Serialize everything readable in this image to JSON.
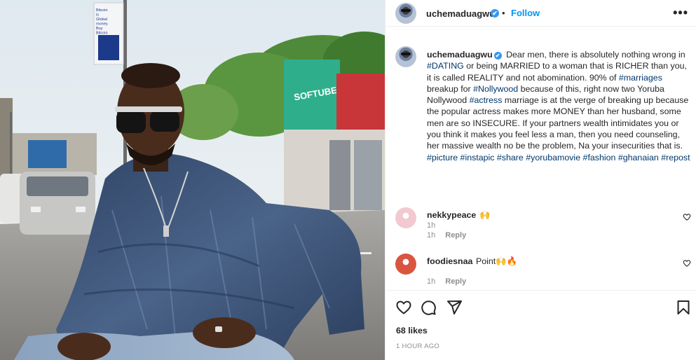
{
  "post": {
    "username": "uchemaduagwu",
    "verified_mark": "✔",
    "separator": "•",
    "follow_label": "Follow",
    "more_label": "•••",
    "photo": {
      "billboard_text": "Bitcoin is Global money. Buy Bitcoin",
      "store_sign": "SOFTUBE"
    }
  },
  "caption": {
    "segments": [
      {
        "t": "Dear men, there is absolutely nothing wrong in "
      },
      {
        "t": "#DATING",
        "tag": true
      },
      {
        "t": " or being MARRIED to a woman that is RICHER than you, it is called REALITY and not abomination. 90% of "
      },
      {
        "t": "#marriages",
        "tag": true
      },
      {
        "t": " breakup for "
      },
      {
        "t": "#Nollywood",
        "tag": true
      },
      {
        "t": " because of this, right now two Yoruba Nollywood "
      },
      {
        "t": "#actress",
        "tag": true
      },
      {
        "t": " marriage is at the verge of breaking up because the popular actress makes more MONEY than her husband, some men are so INSECURE. If your partners wealth intimidates you or you think it makes you feel less a man, then you need counseling, her massive wealth no be the problem, Na your insecurities that is. "
      },
      {
        "t": "#picture",
        "tag": true
      },
      {
        "t": " "
      },
      {
        "t": "#instapic",
        "tag": true
      },
      {
        "t": " "
      },
      {
        "t": "#share",
        "tag": true
      },
      {
        "t": " "
      },
      {
        "t": "#yorubamovie",
        "tag": true
      },
      {
        "t": " "
      },
      {
        "t": "#fashion",
        "tag": true
      },
      {
        "t": " "
      },
      {
        "t": "#ghanaian",
        "tag": true
      },
      {
        "t": " "
      },
      {
        "t": "#repost",
        "tag": true
      }
    ],
    "time": "1h"
  },
  "comments": [
    {
      "username": "nekkypeace",
      "text": "🙌",
      "time": "1h",
      "reply_label": "Reply",
      "avatar_color": "#f2c9d0"
    },
    {
      "username": "foodiesnaa",
      "text": "Point🙌🔥",
      "time": "1h",
      "reply_label": "Reply",
      "avatar_color": "#d9553f"
    }
  ],
  "actions": {
    "icons": [
      "heart-icon",
      "comment-icon",
      "share-icon",
      "bookmark-icon"
    ],
    "likes": "68 likes",
    "time_ago": "1 HOUR AGO"
  },
  "colors": {
    "link": "#0095f6",
    "hashtag": "#00376b",
    "muted": "#8e8e8e",
    "verified": "#3897f0"
  }
}
